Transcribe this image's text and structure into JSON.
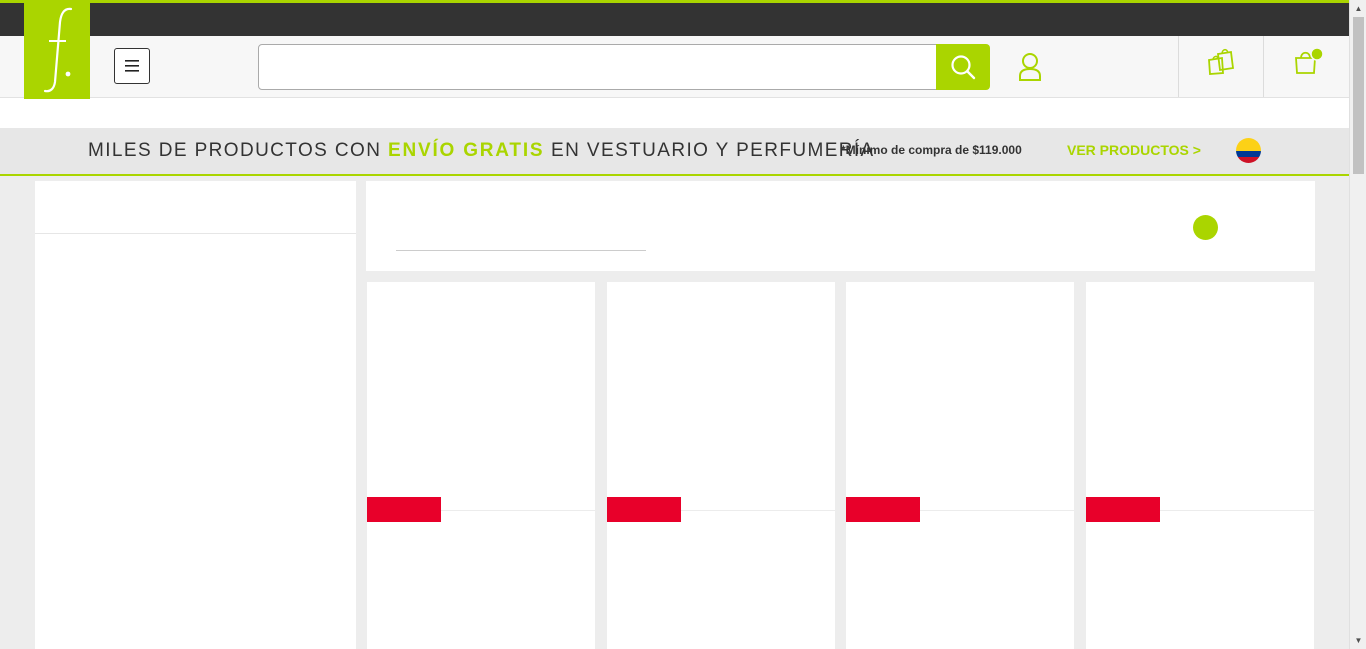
{
  "colors": {
    "brand_green": "#aad500",
    "topbar": "#333333",
    "sale_red": "#e8002a"
  },
  "header": {
    "logo_text": "f.",
    "menu_icon": "hamburger-icon",
    "search": {
      "placeholder": "",
      "value": ""
    },
    "search_icon": "search-icon",
    "user_icon": "user-icon",
    "bag_icon": "shopping-bags-icon",
    "cart_icon": "cart-icon"
  },
  "promo": {
    "text_before": "MILES DE PRODUCTOS CON ",
    "highlight": "ENVÍO GRATIS",
    "text_after": " EN VESTUARIO Y PERFUMERÍA",
    "note": "*Mínimo de compra de $119.000",
    "link": "VER PRODUCTOS >",
    "flag": "colombia-flag-icon"
  },
  "products": [
    {
      "badge": ""
    },
    {
      "badge": ""
    },
    {
      "badge": ""
    },
    {
      "badge": ""
    }
  ]
}
